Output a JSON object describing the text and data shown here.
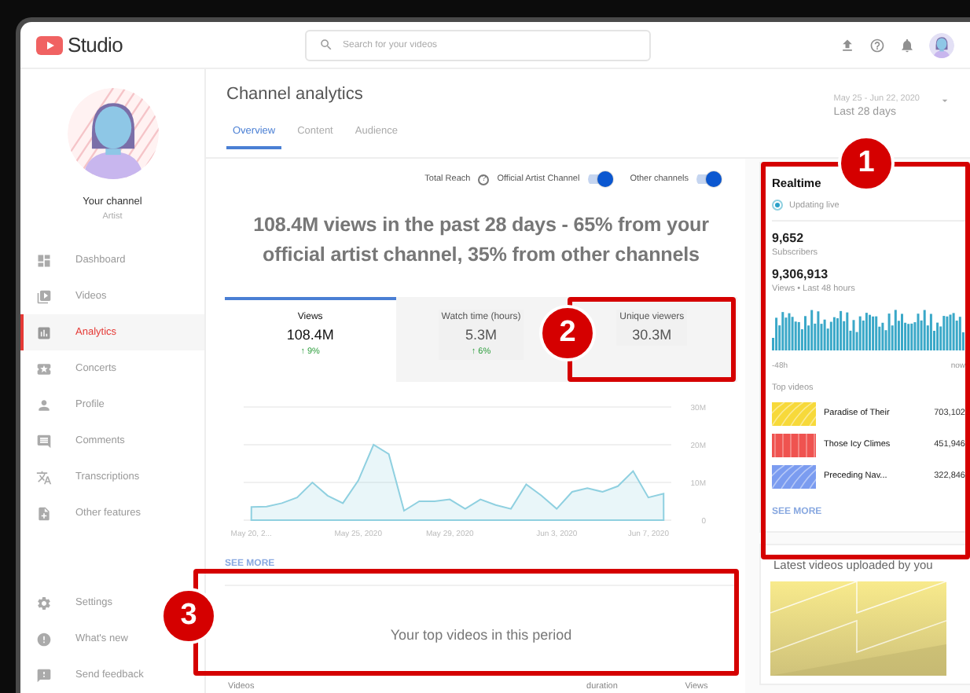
{
  "header": {
    "logo_text": "Studio",
    "search": {
      "placeholder": "Search for your videos"
    }
  },
  "channel": {
    "name": "Your channel",
    "role": "Artist"
  },
  "nav": [
    {
      "label": "Dashboard",
      "selected": false
    },
    {
      "label": "Videos",
      "selected": false
    },
    {
      "label": "Analytics",
      "selected": true
    },
    {
      "label": "Concerts",
      "selected": false
    },
    {
      "label": "Profile",
      "selected": false
    },
    {
      "label": "Comments",
      "selected": false
    },
    {
      "label": "Transcriptions",
      "selected": false
    },
    {
      "label": "Other features",
      "selected": false
    }
  ],
  "nav_footer": [
    {
      "label": "Settings"
    },
    {
      "label": "What's new"
    },
    {
      "label": "Send feedback"
    }
  ],
  "page": {
    "title": "Channel analytics",
    "tabs": [
      {
        "label": "Overview",
        "selected": true
      },
      {
        "label": "Content",
        "selected": false
      },
      {
        "label": "Audience",
        "selected": false
      }
    ],
    "date_range": "May 25 - Jun 22, 2020",
    "period": "Last 28 days"
  },
  "reach": {
    "label": "Total Reach",
    "help": "?",
    "toggles": [
      {
        "label": "Official Artist Channel",
        "on": true
      },
      {
        "label": "Other channels",
        "on": true
      }
    ]
  },
  "headline": "108.4M views in the past 28 days - 65% from your official artist channel, 35% from other channels",
  "metrics": [
    {
      "label": "Views",
      "value": "108.4M",
      "change": "↑ 9%",
      "selected": true
    },
    {
      "label": "Watch time (hours)",
      "value": "5.3M",
      "change": "↑ 6%",
      "selected": false
    },
    {
      "label": "Unique viewers",
      "value": "30.3M",
      "selected": false
    }
  ],
  "chart_data": {
    "type": "area",
    "categories": [
      "May 20, 2...",
      null,
      null,
      null,
      null,
      null,
      null,
      "May 25, 2020",
      null,
      null,
      null,
      null,
      null,
      "May 29, 2020",
      null,
      null,
      null,
      null,
      null,
      null,
      "Jun 3, 2020",
      null,
      null,
      null,
      null,
      null,
      "Jun 7, 2020",
      null
    ],
    "series": [
      {
        "color": "#8fd0e0",
        "values": [
          3.5,
          3.6,
          4.5,
          6,
          10,
          6.5,
          4.5,
          10.5,
          20,
          17.5,
          2.5,
          5,
          5,
          5.5,
          3,
          5.5,
          4,
          3,
          9.5,
          6.5,
          3,
          7.5,
          8.5,
          7.5,
          9,
          13,
          6,
          7
        ]
      }
    ],
    "ylim": [
      0,
      30
    ],
    "yticks": [
      {
        "value": 0,
        "label": "0"
      },
      {
        "value": 10,
        "label": "10M"
      },
      {
        "value": 20,
        "label": "20M"
      },
      {
        "value": 30,
        "label": "30M"
      }
    ]
  },
  "chart_link": "SEE MORE",
  "top_videos": {
    "message": "Your top videos in this period",
    "columns": [
      "Videos",
      "duration",
      "Views"
    ]
  },
  "realtime": {
    "title": "Realtime",
    "status": "Updating live",
    "subscribers": "9,652",
    "subscribers_label": "Subscribers",
    "views": "9,306,913",
    "views_label": "Views • Last 48 hours",
    "axis_start": "-48h",
    "axis_end": "now",
    "list_title": "Top videos",
    "videos": [
      {
        "title": "Paradise of Their",
        "views": "703,102",
        "color": "#f7d93a"
      },
      {
        "title": "Those Icy Climes",
        "views": "451,946",
        "color": "#ef5350"
      },
      {
        "title": "Preceding Nav...",
        "views": "322,846",
        "color": "#7b9cf0"
      }
    ],
    "link": "SEE MORE"
  },
  "latest": {
    "title": "Latest videos uploaded by you"
  },
  "callouts": [
    {
      "label": "1"
    },
    {
      "label": "2"
    },
    {
      "label": "3"
    }
  ]
}
